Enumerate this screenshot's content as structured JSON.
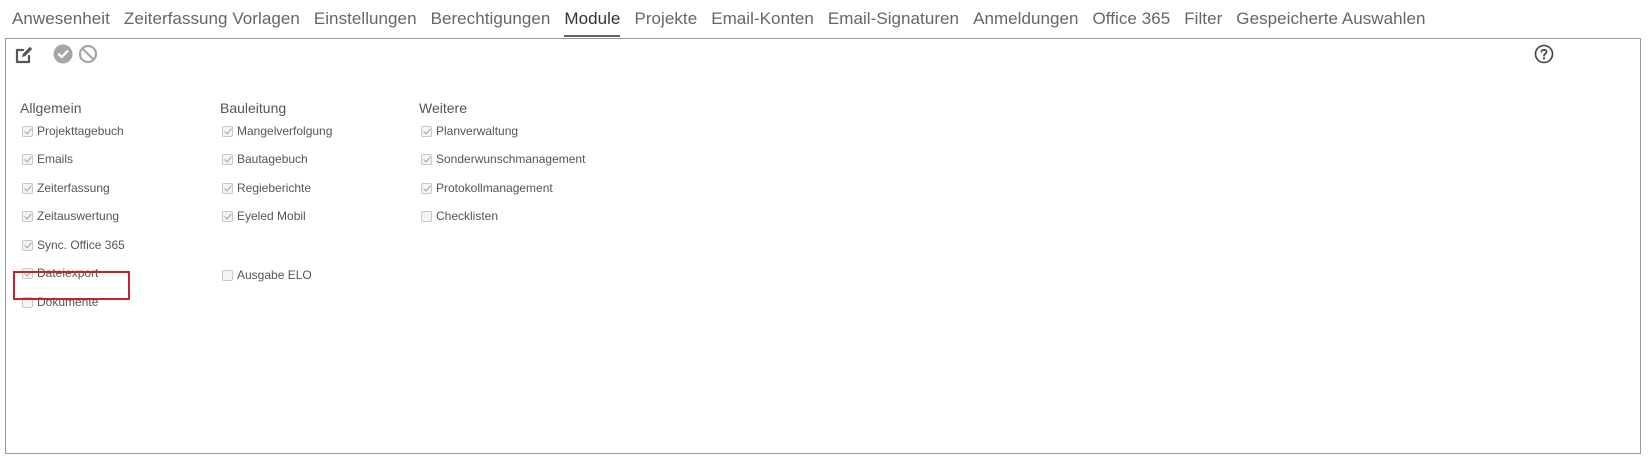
{
  "tabs": [
    {
      "label": "Anwesenheit",
      "active": false
    },
    {
      "label": "Zeiterfassung Vorlagen",
      "active": false
    },
    {
      "label": "Einstellungen",
      "active": false
    },
    {
      "label": "Berechtigungen",
      "active": false
    },
    {
      "label": "Module",
      "active": true
    },
    {
      "label": "Projekte",
      "active": false
    },
    {
      "label": "Email-Konten",
      "active": false
    },
    {
      "label": "Email-Signaturen",
      "active": false
    },
    {
      "label": "Anmeldungen",
      "active": false
    },
    {
      "label": "Office 365",
      "active": false
    },
    {
      "label": "Filter",
      "active": false
    },
    {
      "label": "Gespeicherte Auswahlen",
      "active": false
    }
  ],
  "toolbar": {
    "edit_icon": "edit-icon",
    "confirm_icon": "check-circle-icon",
    "cancel_icon": "ban-icon",
    "help_icon": "help-icon"
  },
  "columns": {
    "allgemein": {
      "heading": "Allgemein",
      "items": [
        {
          "label": "Projekttagebuch",
          "checked": true
        },
        {
          "label": "Emails",
          "checked": true
        },
        {
          "label": "Zeiterfassung",
          "checked": true
        },
        {
          "label": "Zeitauswertung",
          "checked": true
        },
        {
          "label": "Sync. Office 365",
          "checked": true
        },
        {
          "label": "Dateiexport",
          "checked": true
        },
        {
          "label": "Dokumente",
          "checked": false
        }
      ]
    },
    "bauleitung": {
      "heading": "Bauleitung",
      "items": [
        {
          "label": "Mangelverfolgung",
          "checked": true
        },
        {
          "label": "Bautagebuch",
          "checked": true
        },
        {
          "label": "Regieberichte",
          "checked": true
        },
        {
          "label": "Eyeled Mobil",
          "checked": true
        },
        {
          "label": "Ausgabe ELO",
          "checked": false
        }
      ]
    },
    "weitere": {
      "heading": "Weitere",
      "items": [
        {
          "label": "Planverwaltung",
          "checked": true
        },
        {
          "label": "Sonderwunschmanagement",
          "checked": true
        },
        {
          "label": "Protokollmanagement",
          "checked": true
        },
        {
          "label": "Checklisten",
          "checked": false
        }
      ]
    }
  },
  "colors": {
    "highlight": "#cc1f2d",
    "icon_gray": "#9e9e9e",
    "text": "#555555"
  }
}
